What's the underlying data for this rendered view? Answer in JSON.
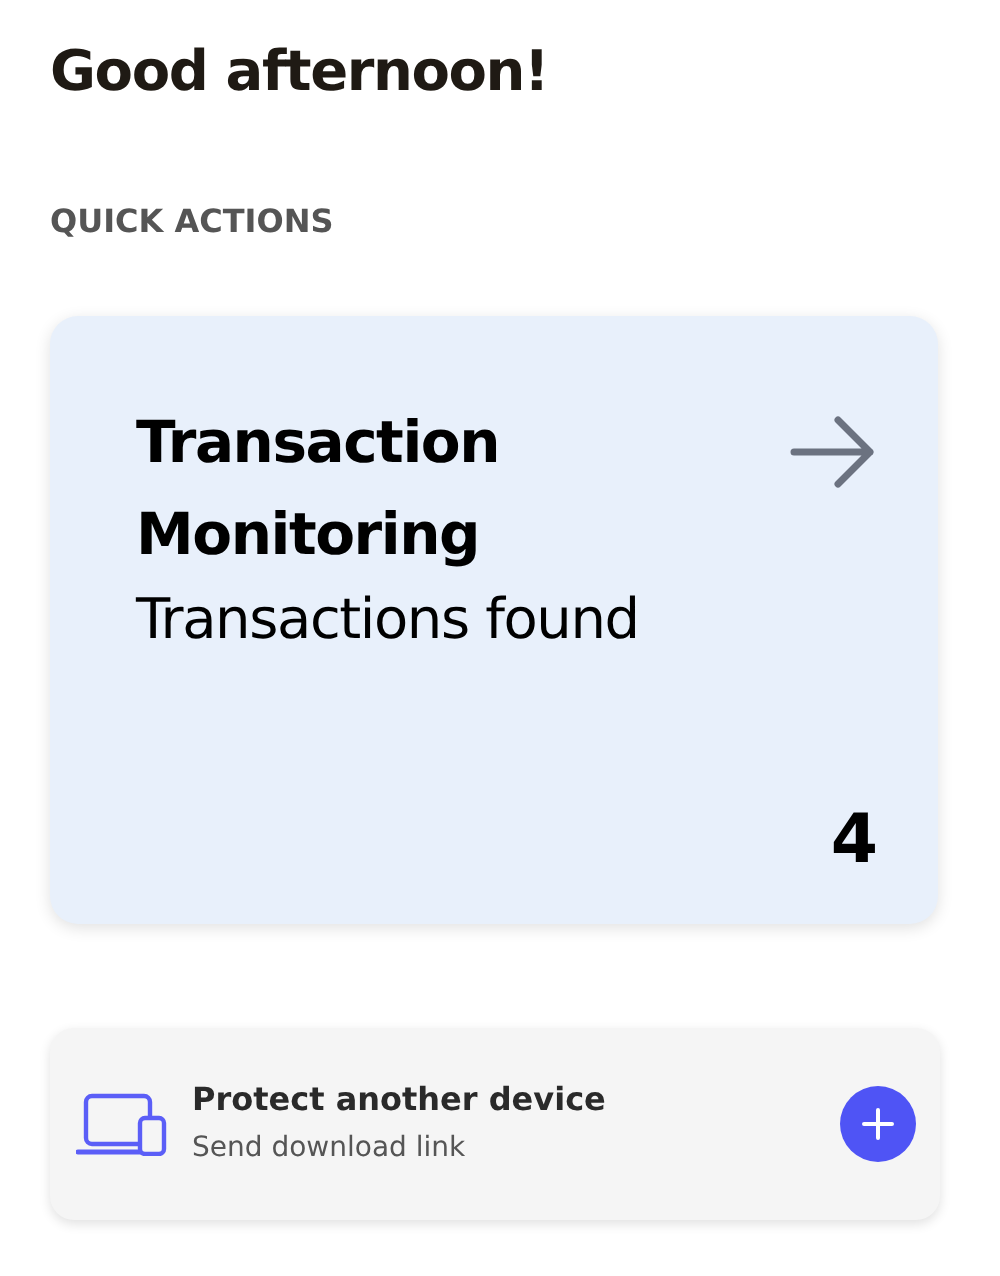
{
  "greeting": "Good afternoon!",
  "section_title": "QUICK ACTIONS",
  "monitoring_card": {
    "title": "Transaction Monitoring",
    "subtitle": "Transactions found",
    "count": "4"
  },
  "device_card": {
    "title": "Protect another device",
    "subtitle": "Send download link"
  }
}
